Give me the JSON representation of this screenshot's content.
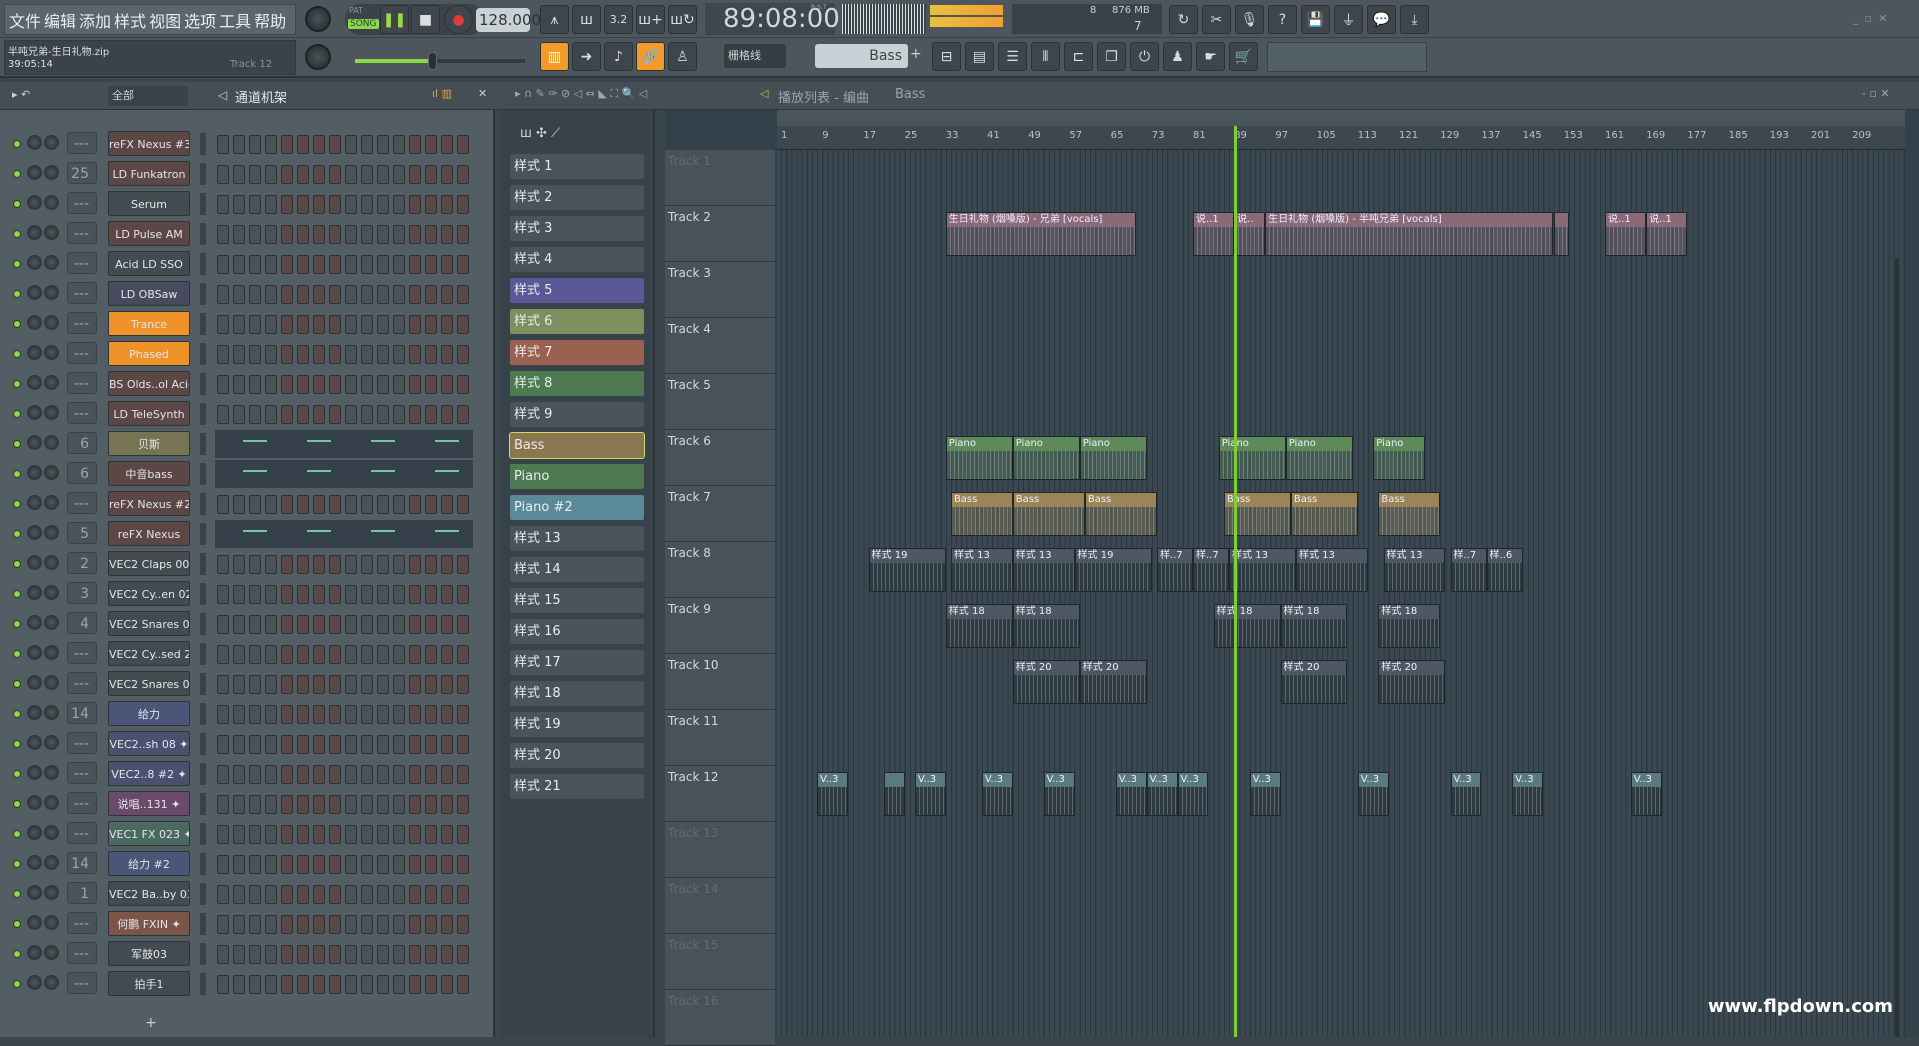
{
  "menu": [
    "文件",
    "编辑",
    "添加",
    "样式",
    "视图",
    "选项",
    "工具",
    "帮助"
  ],
  "transport": {
    "pat": "PAT",
    "song": "SONG",
    "tempo": "128.000",
    "time": "89:08:00",
    "time_label": "B:S:T",
    "cpu": "8",
    "memory": "876 MB",
    "polyphony": "7"
  },
  "project": {
    "file": "半吨兄弟-生日礼物.zip",
    "elapsed": "39:05:14",
    "hint": "Track 12"
  },
  "snap": "栅格线",
  "pattern_selector": "Bass",
  "rack_header": {
    "filter": "全部",
    "title": "通道机架"
  },
  "playlist_header": {
    "title": "播放列表 - 编曲",
    "pattern": "Bass"
  },
  "accent": "#f39a2a",
  "channels": [
    {
      "num": "---",
      "name": "reFX Nexus #3",
      "color": "#5c4646"
    },
    {
      "num": "25",
      "name": "LD Funkatron",
      "color": "#5c4646"
    },
    {
      "num": "---",
      "name": "Serum",
      "color": "#434b50"
    },
    {
      "num": "---",
      "name": "LD Pulse AM",
      "color": "#5c4646"
    },
    {
      "num": "---",
      "name": "Acid LD SSO",
      "color": "#434b50"
    },
    {
      "num": "---",
      "name": "LD OBSaw",
      "color": "#4a4a5e"
    },
    {
      "num": "---",
      "name": "Trance",
      "color": "#f0922a"
    },
    {
      "num": "---",
      "name": "Phased",
      "color": "#f0922a"
    },
    {
      "num": "---",
      "name": "BS Olds..ol Acid",
      "color": "#5c4646"
    },
    {
      "num": "---",
      "name": "LD TeleSynth",
      "color": "#5c4646"
    },
    {
      "num": "6",
      "name": "贝斯",
      "color": "#777454",
      "roll": true
    },
    {
      "num": "6",
      "name": "中音bass",
      "color": "#5c4646",
      "roll": true
    },
    {
      "num": "---",
      "name": "reFX Nexus #2",
      "color": "#5c4646"
    },
    {
      "num": "5",
      "name": "reFX Nexus",
      "color": "#5c4646",
      "roll": true
    },
    {
      "num": "2",
      "name": "VEC2 Claps 006",
      "color": "#434b50"
    },
    {
      "num": "3",
      "name": "VEC2 Cy..en 022",
      "color": "#434b50"
    },
    {
      "num": "4",
      "name": "VEC2 Snares 009",
      "color": "#434b50"
    },
    {
      "num": "---",
      "name": "VEC2 Cy..sed 25",
      "color": "#434b50"
    },
    {
      "num": "---",
      "name": "VEC2 Snares 019",
      "color": "#434b50"
    },
    {
      "num": "14",
      "name": "给力",
      "color": "#4a5578"
    },
    {
      "num": "---",
      "name": "VEC2..sh 08 ✦",
      "color": "#4a5070"
    },
    {
      "num": "---",
      "name": "VEC2..8 #2 ✦",
      "color": "#4a5070"
    },
    {
      "num": "---",
      "name": "说唱..131 ✦",
      "color": "#6a4a6a"
    },
    {
      "num": "---",
      "name": "VEC1 FX 023 ✦",
      "color": "#4a6a60"
    },
    {
      "num": "14",
      "name": "给力 #2",
      "color": "#4a5578"
    },
    {
      "num": "1",
      "name": "VEC2 Ba..by 031",
      "color": "#434b50"
    },
    {
      "num": "---",
      "name": "何鹏 FXIN ✦",
      "color": "#7a5548"
    },
    {
      "num": "---",
      "name": "军鼓03",
      "color": "#434b50"
    },
    {
      "num": "---",
      "name": "拍手1",
      "color": "#434b50"
    }
  ],
  "patterns": [
    {
      "name": "样式 1",
      "color": "#48535c"
    },
    {
      "name": "样式 2",
      "color": "#48535c"
    },
    {
      "name": "样式 3",
      "color": "#48535c"
    },
    {
      "name": "样式 4",
      "color": "#48535c"
    },
    {
      "name": "样式 5",
      "color": "#5c5898"
    },
    {
      "name": "样式 6",
      "color": "#7e8e5e"
    },
    {
      "name": "样式 7",
      "color": "#9a6050"
    },
    {
      "name": "样式 8",
      "color": "#4e7a52"
    },
    {
      "name": "样式 9",
      "color": "#48535c"
    },
    {
      "name": "Bass",
      "color": "#8a7650",
      "selected": true
    },
    {
      "name": "Piano",
      "color": "#4e7a52"
    },
    {
      "name": "Piano #2",
      "color": "#5a8a9a"
    },
    {
      "name": "样式 13",
      "color": "#48535c"
    },
    {
      "name": "样式 14",
      "color": "#48535c"
    },
    {
      "name": "样式 15",
      "color": "#48535c"
    },
    {
      "name": "样式 16",
      "color": "#48535c"
    },
    {
      "name": "样式 17",
      "color": "#48535c"
    },
    {
      "name": "样式 18",
      "color": "#48535c"
    },
    {
      "name": "样式 19",
      "color": "#48535c"
    },
    {
      "name": "样式 20",
      "color": "#48535c"
    },
    {
      "name": "样式 21",
      "color": "#48535c"
    }
  ],
  "tracks": [
    "Track 1",
    "Track 2",
    "Track 3",
    "Track 4",
    "Track 5",
    "Track 6",
    "Track 7",
    "Track 8",
    "Track 9",
    "Track 10",
    "Track 11",
    "Track 12",
    "Track 13",
    "Track 14",
    "Track 15",
    "Track 16"
  ],
  "ruler": [
    "1",
    "9",
    "17",
    "25",
    "33",
    "41",
    "49",
    "57",
    "65",
    "73",
    "81",
    "89",
    "97",
    "105",
    "113",
    "121",
    "129",
    "137",
    "145",
    "153",
    "161",
    "169",
    "177",
    "185",
    "193",
    "201",
    "209"
  ],
  "playhead_bar": 89,
  "clip_colors": {
    "vocal": "#8a6a78",
    "piano": "#5e8a5a",
    "bass": "#9a8458",
    "pat": "#4e5862",
    "audio": "#7a7090",
    "v": "#5a7a80"
  },
  "clips": [
    {
      "t": 2,
      "s": 33,
      "l": 37,
      "n": "生日礼物 (烟嗓版) - 兄弟 [vocals]",
      "c": "vocal"
    },
    {
      "t": 2,
      "s": 81,
      "l": 8,
      "n": "说..1",
      "c": "vocal"
    },
    {
      "t": 2,
      "s": 89,
      "l": 6,
      "n": "说..",
      "c": "vocal"
    },
    {
      "t": 2,
      "s": 95,
      "l": 56,
      "n": "生日礼物 (烟嗓版) - 半吨兄弟 [vocals]",
      "c": "vocal"
    },
    {
      "t": 2,
      "s": 151,
      "l": 3,
      "n": "",
      "c": "vocal"
    },
    {
      "t": 2,
      "s": 161,
      "l": 8,
      "n": "说..1",
      "c": "vocal"
    },
    {
      "t": 2,
      "s": 169,
      "l": 8,
      "n": "说..1",
      "c": "vocal"
    },
    {
      "t": 6,
      "s": 33,
      "l": 13,
      "n": "Piano",
      "c": "piano"
    },
    {
      "t": 6,
      "s": 46,
      "l": 13,
      "n": "Piano",
      "c": "piano"
    },
    {
      "t": 6,
      "s": 59,
      "l": 13,
      "n": "Piano",
      "c": "piano"
    },
    {
      "t": 6,
      "s": 86,
      "l": 13,
      "n": "Piano",
      "c": "piano"
    },
    {
      "t": 6,
      "s": 99,
      "l": 13,
      "n": "Piano",
      "c": "piano"
    },
    {
      "t": 6,
      "s": 116,
      "l": 10,
      "n": "Piano",
      "c": "piano"
    },
    {
      "t": 7,
      "s": 34,
      "l": 12,
      "n": "Bass",
      "c": "bass"
    },
    {
      "t": 7,
      "s": 46,
      "l": 14,
      "n": "Bass",
      "c": "bass"
    },
    {
      "t": 7,
      "s": 60,
      "l": 14,
      "n": "Bass",
      "c": "bass"
    },
    {
      "t": 7,
      "s": 87,
      "l": 13,
      "n": "Bass",
      "c": "bass"
    },
    {
      "t": 7,
      "s": 100,
      "l": 13,
      "n": "Bass",
      "c": "bass"
    },
    {
      "t": 7,
      "s": 117,
      "l": 12,
      "n": "Bass",
      "c": "bass"
    },
    {
      "t": 8,
      "s": 18,
      "l": 15,
      "n": "样式 19",
      "c": "pat"
    },
    {
      "t": 8,
      "s": 34,
      "l": 12,
      "n": "样式 13",
      "c": "pat"
    },
    {
      "t": 8,
      "s": 46,
      "l": 12,
      "n": "样式 13",
      "c": "pat"
    },
    {
      "t": 8,
      "s": 58,
      "l": 15,
      "n": "样式 19",
      "c": "pat"
    },
    {
      "t": 8,
      "s": 74,
      "l": 7,
      "n": "样..7",
      "c": "pat"
    },
    {
      "t": 8,
      "s": 81,
      "l": 7,
      "n": "样..7",
      "c": "pat"
    },
    {
      "t": 8,
      "s": 88,
      "l": 13,
      "n": "样式 13",
      "c": "pat"
    },
    {
      "t": 8,
      "s": 101,
      "l": 14,
      "n": "样式 13",
      "c": "pat"
    },
    {
      "t": 8,
      "s": 118,
      "l": 12,
      "n": "样式 13",
      "c": "pat"
    },
    {
      "t": 8,
      "s": 131,
      "l": 7,
      "n": "样..7",
      "c": "pat"
    },
    {
      "t": 8,
      "s": 138,
      "l": 7,
      "n": "样..6",
      "c": "pat"
    },
    {
      "t": 9,
      "s": 33,
      "l": 13,
      "n": "样式 18",
      "c": "pat"
    },
    {
      "t": 9,
      "s": 46,
      "l": 13,
      "n": "样式 18",
      "c": "pat"
    },
    {
      "t": 9,
      "s": 85,
      "l": 13,
      "n": "样式 18",
      "c": "pat"
    },
    {
      "t": 9,
      "s": 98,
      "l": 13,
      "n": "样式 18",
      "c": "pat"
    },
    {
      "t": 9,
      "s": 117,
      "l": 12,
      "n": "样式 18",
      "c": "pat"
    },
    {
      "t": 10,
      "s": 46,
      "l": 13,
      "n": "样式 20",
      "c": "pat"
    },
    {
      "t": 10,
      "s": 59,
      "l": 13,
      "n": "样式 20",
      "c": "pat"
    },
    {
      "t": 10,
      "s": 98,
      "l": 13,
      "n": "样式 20",
      "c": "pat"
    },
    {
      "t": 10,
      "s": 117,
      "l": 13,
      "n": "样式 20",
      "c": "pat"
    },
    {
      "t": 12,
      "s": 8,
      "l": 6,
      "n": "V..3",
      "c": "v"
    },
    {
      "t": 12,
      "s": 21,
      "l": 4,
      "n": "",
      "c": "v"
    },
    {
      "t": 12,
      "s": 27,
      "l": 6,
      "n": "V..3",
      "c": "v"
    },
    {
      "t": 12,
      "s": 40,
      "l": 6,
      "n": "V..3",
      "c": "v"
    },
    {
      "t": 12,
      "s": 52,
      "l": 6,
      "n": "V..3",
      "c": "v"
    },
    {
      "t": 12,
      "s": 66,
      "l": 6,
      "n": "V..3",
      "c": "v"
    },
    {
      "t": 12,
      "s": 72,
      "l": 6,
      "n": "V..3",
      "c": "v"
    },
    {
      "t": 12,
      "s": 78,
      "l": 6,
      "n": "V..3",
      "c": "v"
    },
    {
      "t": 12,
      "s": 92,
      "l": 6,
      "n": "V..3",
      "c": "v"
    },
    {
      "t": 12,
      "s": 113,
      "l": 6,
      "n": "V..3",
      "c": "v"
    },
    {
      "t": 12,
      "s": 131,
      "l": 6,
      "n": "V..3",
      "c": "v"
    },
    {
      "t": 12,
      "s": 143,
      "l": 6,
      "n": "V..3",
      "c": "v"
    },
    {
      "t": 12,
      "s": 166,
      "l": 6,
      "n": "V..3",
      "c": "v"
    }
  ],
  "watermark": "www.flpdown.com"
}
